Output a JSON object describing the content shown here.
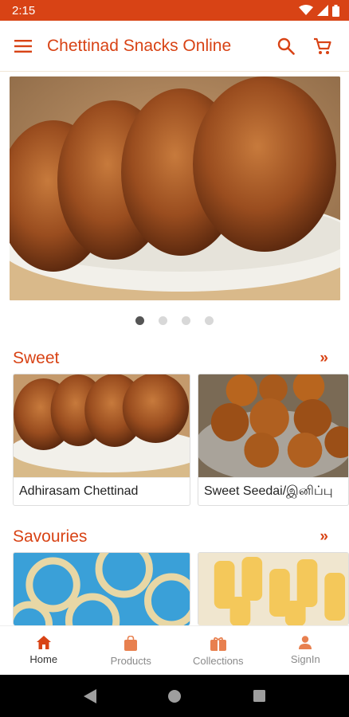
{
  "status_bar": {
    "time": "2:15"
  },
  "app_bar": {
    "title": "Chettinad Snacks Online"
  },
  "banner": {
    "dots": 4,
    "active_dot": 0
  },
  "sections": [
    {
      "title": "Sweet",
      "items": [
        {
          "label": "Adhirasam Chettinad"
        },
        {
          "label": "Sweet Seedai/இனிப்பு"
        }
      ]
    },
    {
      "title": "Savouries",
      "items": []
    }
  ],
  "bottom_nav": [
    {
      "label": "Home",
      "icon": "home-icon",
      "active": true
    },
    {
      "label": "Products",
      "icon": "shopping-bag-icon",
      "active": false
    },
    {
      "label": "Collections",
      "icon": "gift-box-icon",
      "active": false
    },
    {
      "label": "SignIn",
      "icon": "person-icon",
      "active": false
    }
  ],
  "colors": {
    "primary": "#d84315",
    "status_bar": "#d84315",
    "inactive": "#8a8a8a"
  }
}
